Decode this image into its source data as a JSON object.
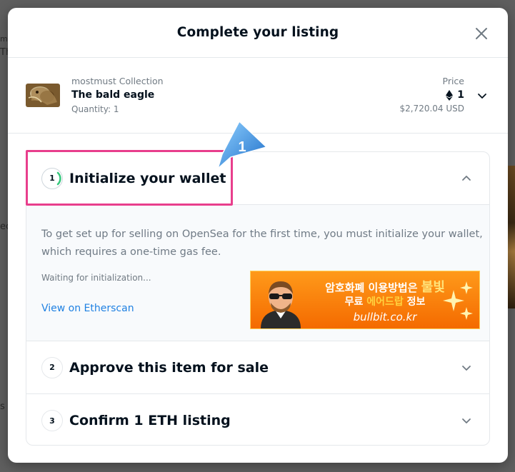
{
  "backdrop": {
    "left_text_1": "m",
    "left_text_2": "Th",
    "left_text_3": "ec",
    "left_text_4": "s"
  },
  "modal": {
    "title": "Complete your listing",
    "close_icon": "close-icon"
  },
  "item": {
    "collection": "mostmust Collection",
    "name": "The bald eagle",
    "quantity": "Quantity: 1",
    "price_label": "Price",
    "price_eth": "1",
    "price_usd": "$2,720.04 USD"
  },
  "steps": [
    {
      "number": "1",
      "title": "Initialize your wallet",
      "expanded": true,
      "description": "To get set up for selling on OpenSea for the first time, you must initialize your wallet, which requires a one-time gas fee.",
      "status": "Waiting for initialization...",
      "link": "View on Etherscan"
    },
    {
      "number": "2",
      "title": "Approve this item for sale",
      "expanded": false
    },
    {
      "number": "3",
      "title": "Confirm 1 ETH listing",
      "expanded": false
    }
  ],
  "ad": {
    "line1_pre": "암호화폐 이용방법은 ",
    "line1_brand": "불빛",
    "line2_pre": "무료 ",
    "line2_highlight": "에어드랍",
    "line2_post": " 정보",
    "url": "bullbit.co.kr"
  },
  "annotation": {
    "callout_number": "1",
    "highlight_color": "#e83e8c",
    "callout_color": "#3a8ee6"
  },
  "colors": {
    "link": "#2081e2",
    "text_primary": "#04111d",
    "text_secondary": "#707a83",
    "spinner": "#34c77b"
  }
}
